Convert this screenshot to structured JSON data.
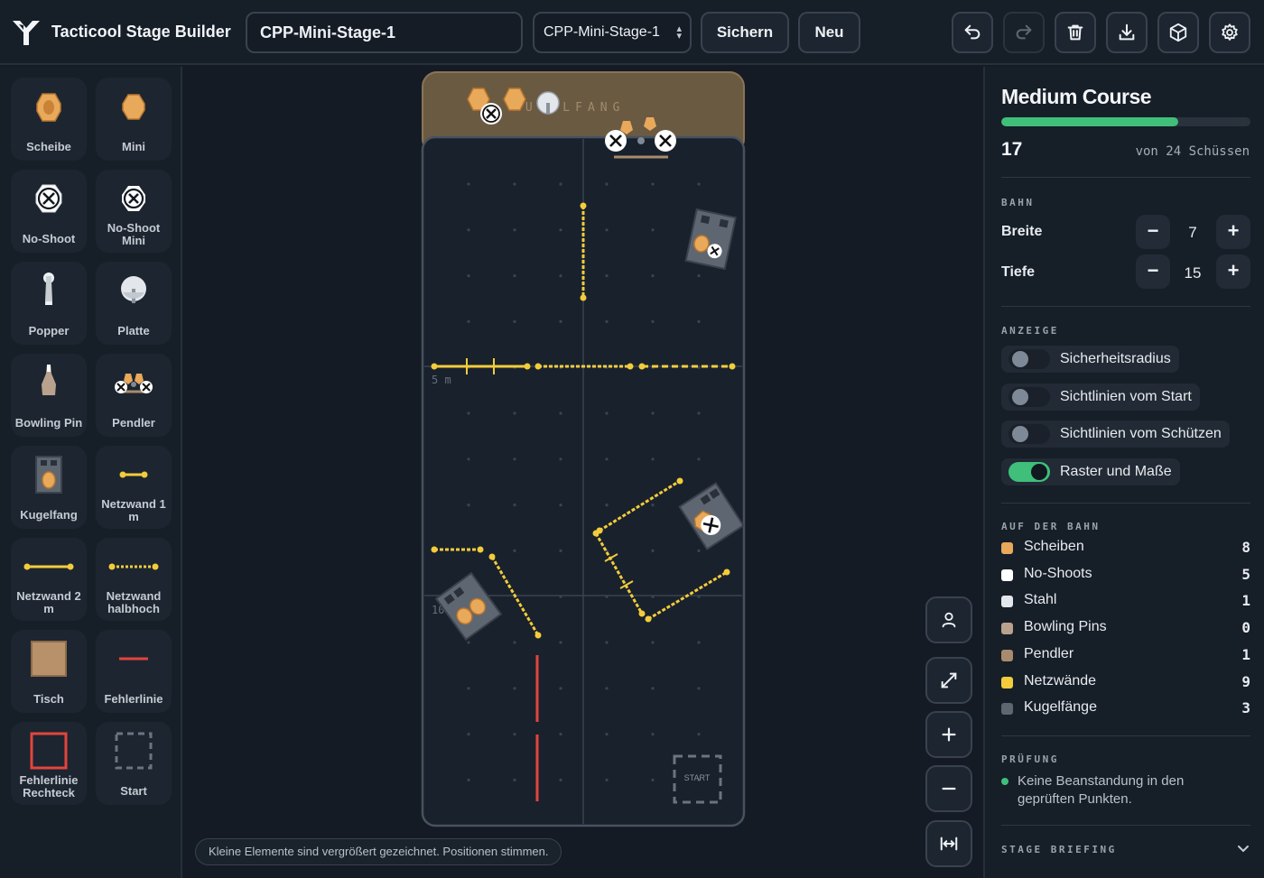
{
  "app": {
    "title": "Tacticool Stage Builder"
  },
  "toolbar": {
    "stage_name": "CPP-Mini-Stage-1",
    "stage_select": "CPP-Mini-Stage-1",
    "save_label": "Sichern",
    "new_label": "Neu",
    "icons": [
      "undo-icon",
      "redo-icon",
      "trash-icon",
      "download-icon",
      "cube-icon",
      "gear-icon"
    ]
  },
  "palette": {
    "items": [
      {
        "label": "Scheibe",
        "icon": "target-icon"
      },
      {
        "label": "Mini",
        "icon": "mini-target-icon"
      },
      {
        "label": "No-Shoot",
        "icon": "no-shoot-icon"
      },
      {
        "label": "No-Shoot Mini",
        "icon": "no-shoot-mini-icon"
      },
      {
        "label": "Popper",
        "icon": "popper-icon"
      },
      {
        "label": "Platte",
        "icon": "plate-icon"
      },
      {
        "label": "Bowling Pin",
        "icon": "bowling-pin-icon"
      },
      {
        "label": "Pendler",
        "icon": "swinger-icon"
      },
      {
        "label": "Kugelfang",
        "icon": "backstop-icon"
      },
      {
        "label": "Netzwand 1 m",
        "icon": "wall-1m-icon"
      },
      {
        "label": "Netzwand 2 m",
        "icon": "wall-2m-icon"
      },
      {
        "label": "Netzwand halbhoch",
        "icon": "wall-half-icon"
      },
      {
        "label": "Tisch",
        "icon": "table-icon"
      },
      {
        "label": "Fehlerlinie",
        "icon": "fault-line-icon"
      },
      {
        "label": "Fehlerlinie Rechteck",
        "icon": "fault-rect-icon"
      },
      {
        "label": "Start",
        "icon": "start-box-icon"
      }
    ]
  },
  "canvas": {
    "backstop_label": "KUGELFANG",
    "dist_label_5": "5 m",
    "dist_label_10": "10",
    "start_label": "START",
    "hint": "Kleine Elemente sind vergrößert gezeichnet. Positionen stimmen.",
    "side_buttons": [
      "shooter-icon",
      "expand-icon",
      "zoom-in-icon",
      "zoom-out-icon",
      "fit-width-icon"
    ]
  },
  "summary": {
    "course_name": "Medium Course",
    "shots": "17",
    "shots_total": "von 24 Schüssen",
    "shots_value": 17,
    "shots_max": 24,
    "color_progress": "#3fbf7a"
  },
  "bahn": {
    "section": "BAHN",
    "width_label": "Breite",
    "width_value": "7",
    "depth_label": "Tiefe",
    "depth_value": "15"
  },
  "anzeige": {
    "section": "ANZEIGE",
    "toggles": [
      {
        "label": "Sicherheitsradius",
        "on": false
      },
      {
        "label": "Sichtlinien vom Start",
        "on": false
      },
      {
        "label": "Sichtlinien vom Schützen",
        "on": false
      },
      {
        "label": "Raster und Maße",
        "on": true
      }
    ]
  },
  "counts": {
    "section": "AUF DER BAHN",
    "items": [
      {
        "label": "Scheiben",
        "value": "8",
        "color": "#e8a95a"
      },
      {
        "label": "No-Shoots",
        "value": "5",
        "color": "#ffffff"
      },
      {
        "label": "Stahl",
        "value": "1",
        "color": "#e3e6ea"
      },
      {
        "label": "Bowling Pins",
        "value": "0",
        "color": "#b8a28e"
      },
      {
        "label": "Pendler",
        "value": "1",
        "color": "#a88b6c"
      },
      {
        "label": "Netzwände",
        "value": "9",
        "color": "#f2cc3b"
      },
      {
        "label": "Kugelfänge",
        "value": "3",
        "color": "#5e6672"
      }
    ]
  },
  "pruefung": {
    "section": "PRÜFUNG",
    "message": "Keine Beanstandung in den geprüften Punkten."
  },
  "briefing": {
    "section": "STAGE BRIEFING"
  }
}
